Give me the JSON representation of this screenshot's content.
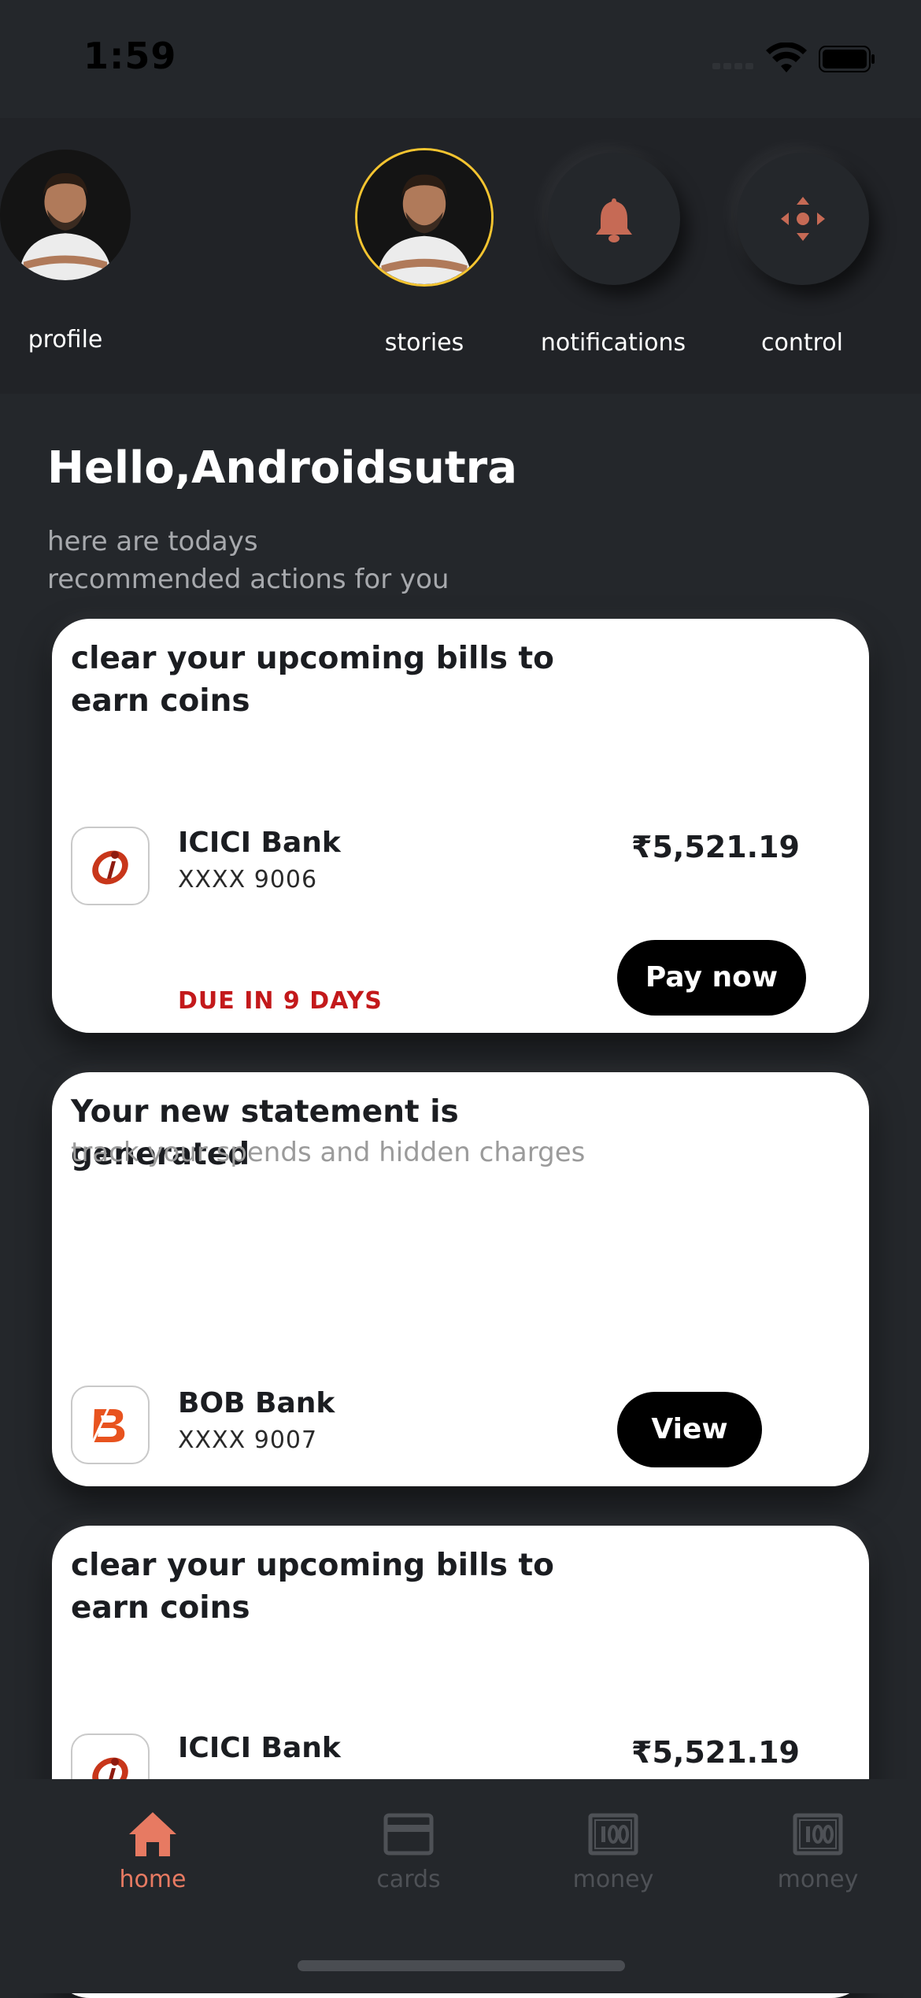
{
  "status_bar": {
    "time": "1:59"
  },
  "header": {
    "profile_label": "profile",
    "stories_label": "stories",
    "notifications_label": "notifications",
    "control_label": "control",
    "accent_ring": "#f4c430",
    "icon_color": "#c66a55"
  },
  "greeting": {
    "title": "Hello,Androidsutra",
    "subtitle_line1": "here are todays",
    "subtitle_line2": "recommended actions for you"
  },
  "cards": [
    {
      "title": "clear your upcoming bills to earn coins",
      "bank": "ICICI Bank",
      "account": "XXXX 9006",
      "amount": "₹5,521.19",
      "due": "DUE IN 9 DAYS",
      "button": "Pay now"
    },
    {
      "title": "Your new statement is generated",
      "subtitle": "track your spends and hidden charges",
      "bank": "BOB Bank",
      "account": "XXXX 9007",
      "button": "View"
    },
    {
      "title": "clear your upcoming bills to earn coins",
      "bank": "ICICI Bank",
      "amount": "₹5,521.19"
    }
  ],
  "bottom_nav": [
    {
      "label": "home",
      "icon": "home-icon",
      "active": true
    },
    {
      "label": "cards",
      "icon": "card-icon",
      "active": false
    },
    {
      "label": "money",
      "icon": "money-icon",
      "active": false
    },
    {
      "label": "money",
      "icon": "money-icon",
      "active": false
    }
  ],
  "colors": {
    "background": "#24272b",
    "active_tab": "#e77a62",
    "due_red": "#c3191b",
    "button_black": "#000000"
  }
}
